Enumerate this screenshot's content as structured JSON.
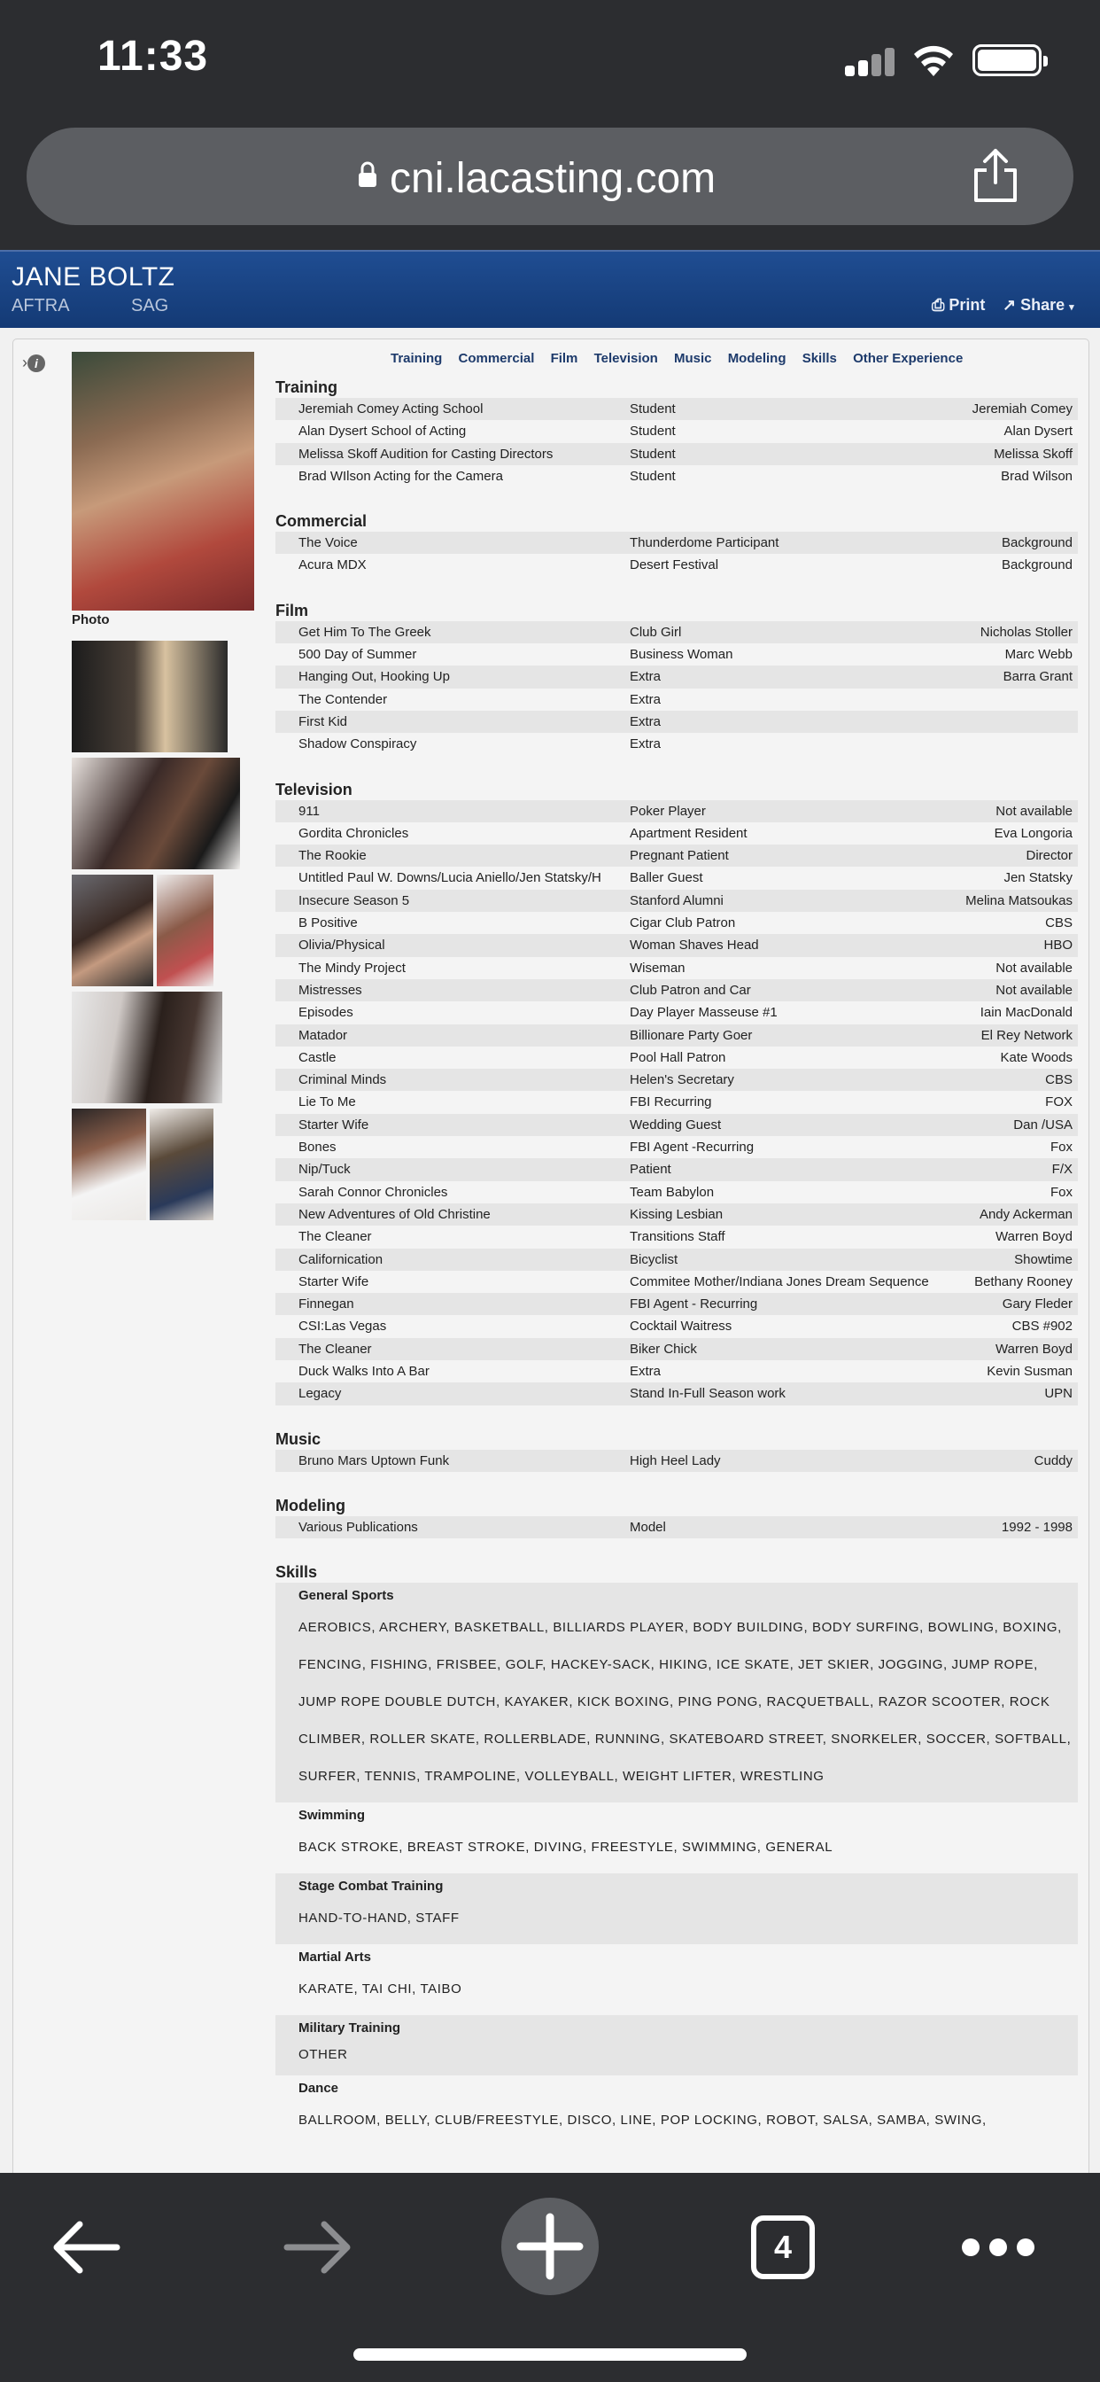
{
  "status": {
    "time": "11:33"
  },
  "browser": {
    "url": "cni.lacasting.com",
    "tab_count": "4"
  },
  "profile": {
    "name": "JANE BOLTZ",
    "unions": [
      "AFTRA",
      "SAG"
    ],
    "print_label": "Print",
    "share_label": "Share",
    "photo_label": "Photo"
  },
  "nav": [
    "Training",
    "Commercial",
    "Film",
    "Television",
    "Music",
    "Modeling",
    "Skills",
    "Other Experience"
  ],
  "sections": [
    {
      "title": "Training",
      "rows": [
        [
          "Jeremiah Comey Acting School",
          "Student",
          "Jeremiah Comey"
        ],
        [
          "Alan Dysert School of Acting",
          "Student",
          "Alan Dysert"
        ],
        [
          "Melissa Skoff Audition for Casting Directors",
          "Student",
          "Melissa Skoff"
        ],
        [
          "Brad WIlson Acting for the Camera",
          "Student",
          "Brad Wilson"
        ]
      ]
    },
    {
      "title": "Commercial",
      "rows": [
        [
          "The Voice",
          "Thunderdome Participant",
          "Background"
        ],
        [
          "Acura MDX",
          "Desert Festival",
          "Background"
        ]
      ]
    },
    {
      "title": "Film",
      "rows": [
        [
          "Get Him To The Greek",
          "Club Girl",
          "Nicholas Stoller"
        ],
        [
          "500 Day of Summer",
          "Business Woman",
          "Marc Webb"
        ],
        [
          "Hanging Out, Hooking Up",
          "Extra",
          "Barra Grant"
        ],
        [
          "The Contender",
          "Extra",
          ""
        ],
        [
          "First Kid",
          "Extra",
          ""
        ],
        [
          "Shadow Conspiracy",
          "Extra",
          ""
        ]
      ]
    },
    {
      "title": "Television",
      "rows": [
        [
          "911",
          "Poker Player",
          "Not available"
        ],
        [
          "Gordita Chronicles",
          "Apartment Resident",
          "Eva Longoria"
        ],
        [
          "The Rookie",
          "Pregnant Patient",
          "Director"
        ],
        [
          "Untitled Paul W. Downs/Lucia Aniello/Jen Statsky/H",
          "Baller Guest",
          "Jen Statsky"
        ],
        [
          "Insecure Season 5",
          "Stanford Alumni",
          "Melina Matsoukas"
        ],
        [
          "B Positive",
          "Cigar Club Patron",
          "CBS"
        ],
        [
          "Olivia/Physical",
          "Woman Shaves Head",
          "HBO"
        ],
        [
          "The Mindy Project",
          "Wiseman",
          "Not available"
        ],
        [
          "Mistresses",
          "Club Patron and Car",
          "Not available"
        ],
        [
          "Episodes",
          "Day Player Masseuse #1",
          "Iain MacDonald"
        ],
        [
          "Matador",
          "Billionare Party Goer",
          "El Rey Network"
        ],
        [
          "Castle",
          "Pool Hall Patron",
          "Kate Woods"
        ],
        [
          "Criminal Minds",
          "Helen's Secretary",
          "CBS"
        ],
        [
          "Lie To Me",
          "FBI Recurring",
          "FOX"
        ],
        [
          "Starter Wife",
          "Wedding Guest",
          "Dan /USA"
        ],
        [
          "Bones",
          "FBI Agent -Recurring",
          "Fox"
        ],
        [
          "Nip/Tuck",
          "Patient",
          "F/X"
        ],
        [
          "Sarah Connor Chronicles",
          "Team Babylon",
          "Fox"
        ],
        [
          "New Adventures of Old Christine",
          "Kissing Lesbian",
          "Andy Ackerman"
        ],
        [
          "The Cleaner",
          "Transitions Staff",
          "Warren Boyd"
        ],
        [
          "Californication",
          "Bicyclist",
          "Showtime"
        ],
        [
          "Starter Wife",
          "Commitee Mother/Indiana Jones Dream Sequence",
          "Bethany Rooney"
        ],
        [
          "Finnegan",
          "FBI Agent - Recurring",
          "Gary Fleder"
        ],
        [
          "CSI:Las Vegas",
          "Cocktail Waitress",
          "CBS #902"
        ],
        [
          "The Cleaner",
          "Biker Chick",
          "Warren Boyd"
        ],
        [
          "Duck Walks Into A Bar",
          "Extra",
          "Kevin Susman"
        ],
        [
          "Legacy",
          "Stand In-Full Season work",
          "UPN"
        ]
      ]
    },
    {
      "title": "Music",
      "rows": [
        [
          "Bruno Mars Uptown Funk",
          "High Heel Lady",
          "Cuddy"
        ]
      ]
    },
    {
      "title": "Modeling",
      "rows": [
        [
          "Various Publications",
          "Model",
          "1992 - 1998"
        ]
      ]
    }
  ],
  "skills": {
    "title": "Skills",
    "groups": [
      {
        "name": "General Sports",
        "items": "AEROBICS, ARCHERY, BASKETBALL, BILLIARDS PLAYER, BODY BUILDING, BODY SURFING, BOWLING, BOXING, FENCING, FISHING, FRISBEE, GOLF, HACKEY-SACK, HIKING, ICE SKATE, JET SKIER, JOGGING, JUMP ROPE, JUMP ROPE DOUBLE DUTCH, KAYAKER, KICK BOXING, PING PONG, RACQUETBALL, RAZOR SCOOTER, ROCK CLIMBER, ROLLER SKATE, ROLLERBLADE, RUNNING, SKATEBOARD STREET, SNORKELER, SOCCER, SOFTBALL, SURFER, TENNIS, TRAMPOLINE, VOLLEYBALL, WEIGHT LIFTER, WRESTLING"
      },
      {
        "name": "Swimming",
        "items": "BACK STROKE, BREAST STROKE, DIVING, FREESTYLE, SWIMMING, GENERAL"
      },
      {
        "name": "Stage Combat Training",
        "items": "HAND-TO-HAND, STAFF"
      },
      {
        "name": "Martial Arts",
        "items": "KARATE, TAI CHI, TAIBO"
      },
      {
        "name": "Military Training",
        "items": "OTHER"
      },
      {
        "name": "Dance",
        "items": "BALLROOM, BELLY, CLUB/FREESTYLE, DISCO, LINE, POP LOCKING, ROBOT, SALSA, SAMBA, SWING,"
      }
    ]
  }
}
